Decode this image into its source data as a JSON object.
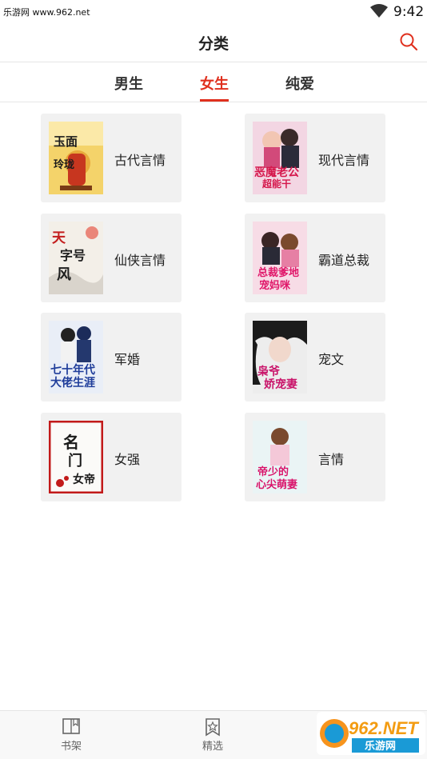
{
  "status_bar": {
    "watermark": "乐游网 www.962.net",
    "time": "9:42"
  },
  "header": {
    "title": "分类"
  },
  "tabs": [
    {
      "label": "男生",
      "active": false
    },
    {
      "label": "女生",
      "active": true
    },
    {
      "label": "纯爱",
      "active": false
    }
  ],
  "categories": [
    {
      "label": "古代言情",
      "cover_text": "玉面玲珑"
    },
    {
      "label": "现代言情",
      "cover_text": "恶魔老公超能干"
    },
    {
      "label": "仙侠言情",
      "cover_text": "天字号风"
    },
    {
      "label": "霸道总裁",
      "cover_text": "总裁爹地宠妈咪"
    },
    {
      "label": "军婚",
      "cover_text": "七十年代大佬生涯"
    },
    {
      "label": "宠文",
      "cover_text": "枭爷娇宠妻"
    },
    {
      "label": "女强",
      "cover_text": "名门女帝"
    },
    {
      "label": "言情",
      "cover_text": "帝少的心尖萌妻"
    }
  ],
  "bottom_nav": [
    {
      "label": "书架",
      "icon": "book-icon"
    },
    {
      "label": "精选",
      "icon": "bookmark-star-icon"
    }
  ],
  "badge": {
    "text": "962.NET",
    "sub": "乐游网"
  },
  "colors": {
    "accent": "#e0301e",
    "card_bg": "#f1f1f1"
  }
}
